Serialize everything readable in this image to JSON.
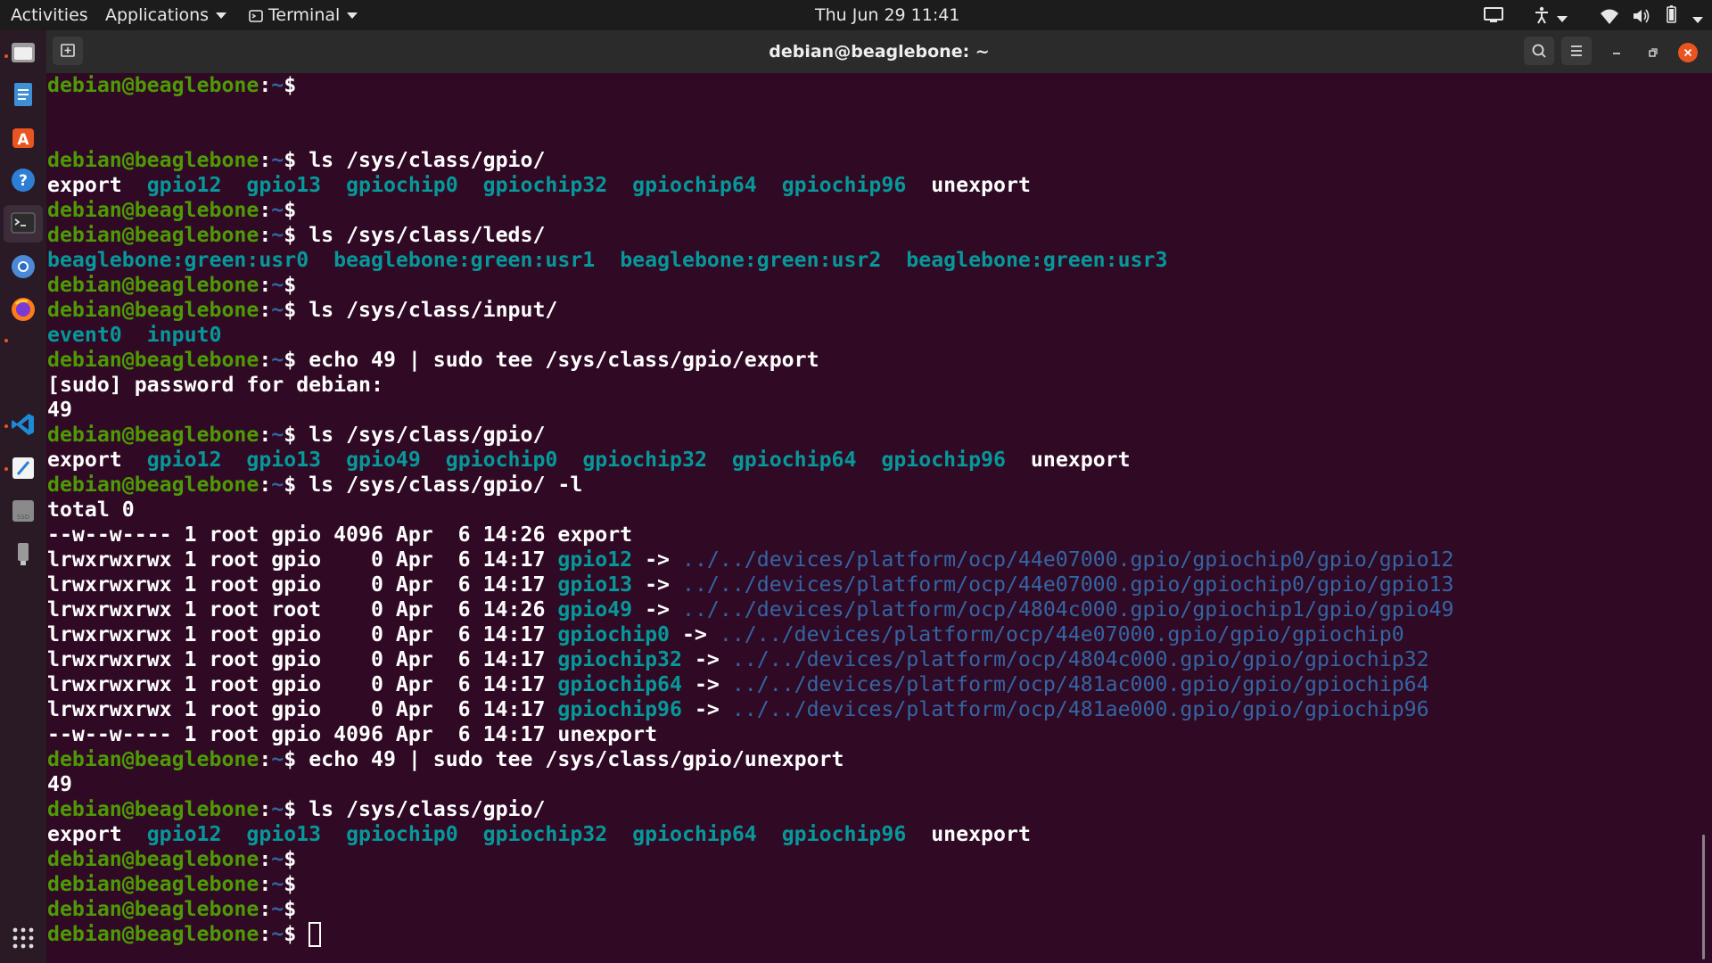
{
  "topbar": {
    "activities": "Activities",
    "applications": "Applications",
    "terminal_menu": "Terminal",
    "clock": "Thu Jun 29  11:41"
  },
  "window": {
    "title": "debian@beaglebone: ~"
  },
  "colors": {
    "terminal_bg": "#300a24",
    "prompt_user": "#4e9a06",
    "prompt_path": "#3465a4",
    "dir_cyan": "#06989a",
    "link_target": "#3465a4",
    "close_button": "#e9541f"
  },
  "dock": {
    "icons": [
      "files-icon",
      "text-editor-icon",
      "software-center-icon",
      "help-icon",
      "terminal-icon",
      "chromium-icon",
      "firefox-icon",
      "vscode-icon",
      "notes-icon",
      "disk-icon",
      "usb-drive-icon",
      "show-apps-icon"
    ]
  },
  "prompt": {
    "user": "debian@beaglebone",
    "sep": ":",
    "path": "~",
    "dollar": "$"
  },
  "lines": [
    {
      "type": "prompt",
      "cmd": ""
    },
    {
      "type": "blank"
    },
    {
      "type": "blank"
    },
    {
      "type": "prompt",
      "cmd": " ls /sys/class/gpio/"
    },
    {
      "type": "out",
      "segs": [
        [
          "wh",
          "export"
        ],
        [
          "wh",
          "  "
        ],
        [
          "cy",
          "gpio12"
        ],
        [
          "wh",
          "  "
        ],
        [
          "cy",
          "gpio13"
        ],
        [
          "wh",
          "  "
        ],
        [
          "cy",
          "gpiochip0"
        ],
        [
          "wh",
          "  "
        ],
        [
          "cy",
          "gpiochip32"
        ],
        [
          "wh",
          "  "
        ],
        [
          "cy",
          "gpiochip64"
        ],
        [
          "wh",
          "  "
        ],
        [
          "cy",
          "gpiochip96"
        ],
        [
          "wh",
          "  "
        ],
        [
          "wh",
          "unexport"
        ]
      ]
    },
    {
      "type": "prompt",
      "cmd": ""
    },
    {
      "type": "prompt",
      "cmd": " ls /sys/class/leds/"
    },
    {
      "type": "out",
      "segs": [
        [
          "cy",
          "beaglebone:green:usr0"
        ],
        [
          "wh",
          "  "
        ],
        [
          "cy",
          "beaglebone:green:usr1"
        ],
        [
          "wh",
          "  "
        ],
        [
          "cy",
          "beaglebone:green:usr2"
        ],
        [
          "wh",
          "  "
        ],
        [
          "cy",
          "beaglebone:green:usr3"
        ]
      ]
    },
    {
      "type": "prompt",
      "cmd": ""
    },
    {
      "type": "prompt",
      "cmd": " ls /sys/class/input/"
    },
    {
      "type": "out",
      "segs": [
        [
          "cy",
          "event0"
        ],
        [
          "wh",
          "  "
        ],
        [
          "cy",
          "input0"
        ]
      ]
    },
    {
      "type": "prompt",
      "cmd": " echo 49 | sudo tee /sys/class/gpio/export"
    },
    {
      "type": "out",
      "segs": [
        [
          "wh",
          "[sudo] password for debian:"
        ]
      ]
    },
    {
      "type": "out",
      "segs": [
        [
          "wh",
          "49"
        ]
      ]
    },
    {
      "type": "prompt",
      "cmd": " ls /sys/class/gpio/"
    },
    {
      "type": "out",
      "segs": [
        [
          "wh",
          "export"
        ],
        [
          "wh",
          "  "
        ],
        [
          "cy",
          "gpio12"
        ],
        [
          "wh",
          "  "
        ],
        [
          "cy",
          "gpio13"
        ],
        [
          "wh",
          "  "
        ],
        [
          "cy",
          "gpio49"
        ],
        [
          "wh",
          "  "
        ],
        [
          "cy",
          "gpiochip0"
        ],
        [
          "wh",
          "  "
        ],
        [
          "cy",
          "gpiochip32"
        ],
        [
          "wh",
          "  "
        ],
        [
          "cy",
          "gpiochip64"
        ],
        [
          "wh",
          "  "
        ],
        [
          "cy",
          "gpiochip96"
        ],
        [
          "wh",
          "  "
        ],
        [
          "wh",
          "unexport"
        ]
      ]
    },
    {
      "type": "prompt",
      "cmd": " ls /sys/class/gpio/ -l"
    },
    {
      "type": "out",
      "segs": [
        [
          "wh",
          "total 0"
        ]
      ]
    },
    {
      "type": "out",
      "segs": [
        [
          "wh",
          "--w--w---- 1 root gpio 4096 Apr  6 14:26 export"
        ]
      ]
    },
    {
      "type": "out",
      "segs": [
        [
          "wh",
          "lrwxrwxrwx 1 root gpio    0 Apr  6 14:17 "
        ],
        [
          "cy",
          "gpio12"
        ],
        [
          "wh",
          " -> "
        ],
        [
          "bl",
          "../../devices/platform/ocp/44e07000.gpio/gpiochip0/gpio/gpio12"
        ]
      ]
    },
    {
      "type": "out",
      "segs": [
        [
          "wh",
          "lrwxrwxrwx 1 root gpio    0 Apr  6 14:17 "
        ],
        [
          "cy",
          "gpio13"
        ],
        [
          "wh",
          " -> "
        ],
        [
          "bl",
          "../../devices/platform/ocp/44e07000.gpio/gpiochip0/gpio/gpio13"
        ]
      ]
    },
    {
      "type": "out",
      "segs": [
        [
          "wh",
          "lrwxrwxrwx 1 root root    0 Apr  6 14:26 "
        ],
        [
          "cy",
          "gpio49"
        ],
        [
          "wh",
          " -> "
        ],
        [
          "bl",
          "../../devices/platform/ocp/4804c000.gpio/gpiochip1/gpio/gpio49"
        ]
      ]
    },
    {
      "type": "out",
      "segs": [
        [
          "wh",
          "lrwxrwxrwx 1 root gpio    0 Apr  6 14:17 "
        ],
        [
          "cy",
          "gpiochip0"
        ],
        [
          "wh",
          " -> "
        ],
        [
          "bl",
          "../../devices/platform/ocp/44e07000.gpio/gpio/gpiochip0"
        ]
      ]
    },
    {
      "type": "out",
      "segs": [
        [
          "wh",
          "lrwxrwxrwx 1 root gpio    0 Apr  6 14:17 "
        ],
        [
          "cy",
          "gpiochip32"
        ],
        [
          "wh",
          " -> "
        ],
        [
          "bl",
          "../../devices/platform/ocp/4804c000.gpio/gpio/gpiochip32"
        ]
      ]
    },
    {
      "type": "out",
      "segs": [
        [
          "wh",
          "lrwxrwxrwx 1 root gpio    0 Apr  6 14:17 "
        ],
        [
          "cy",
          "gpiochip64"
        ],
        [
          "wh",
          " -> "
        ],
        [
          "bl",
          "../../devices/platform/ocp/481ac000.gpio/gpio/gpiochip64"
        ]
      ]
    },
    {
      "type": "out",
      "segs": [
        [
          "wh",
          "lrwxrwxrwx 1 root gpio    0 Apr  6 14:17 "
        ],
        [
          "cy",
          "gpiochip96"
        ],
        [
          "wh",
          " -> "
        ],
        [
          "bl",
          "../../devices/platform/ocp/481ae000.gpio/gpio/gpiochip96"
        ]
      ]
    },
    {
      "type": "out",
      "segs": [
        [
          "wh",
          "--w--w---- 1 root gpio 4096 Apr  6 14:17 unexport"
        ]
      ]
    },
    {
      "type": "prompt",
      "cmd": " echo 49 | sudo tee /sys/class/gpio/unexport"
    },
    {
      "type": "out",
      "segs": [
        [
          "wh",
          "49"
        ]
      ]
    },
    {
      "type": "prompt",
      "cmd": " ls /sys/class/gpio/"
    },
    {
      "type": "out",
      "segs": [
        [
          "wh",
          "export"
        ],
        [
          "wh",
          "  "
        ],
        [
          "cy",
          "gpio12"
        ],
        [
          "wh",
          "  "
        ],
        [
          "cy",
          "gpio13"
        ],
        [
          "wh",
          "  "
        ],
        [
          "cy",
          "gpiochip0"
        ],
        [
          "wh",
          "  "
        ],
        [
          "cy",
          "gpiochip32"
        ],
        [
          "wh",
          "  "
        ],
        [
          "cy",
          "gpiochip64"
        ],
        [
          "wh",
          "  "
        ],
        [
          "cy",
          "gpiochip96"
        ],
        [
          "wh",
          "  "
        ],
        [
          "wh",
          "unexport"
        ]
      ]
    },
    {
      "type": "prompt",
      "cmd": ""
    },
    {
      "type": "prompt",
      "cmd": ""
    },
    {
      "type": "prompt",
      "cmd": ""
    },
    {
      "type": "prompt",
      "cmd": " ",
      "cursor": true
    }
  ]
}
